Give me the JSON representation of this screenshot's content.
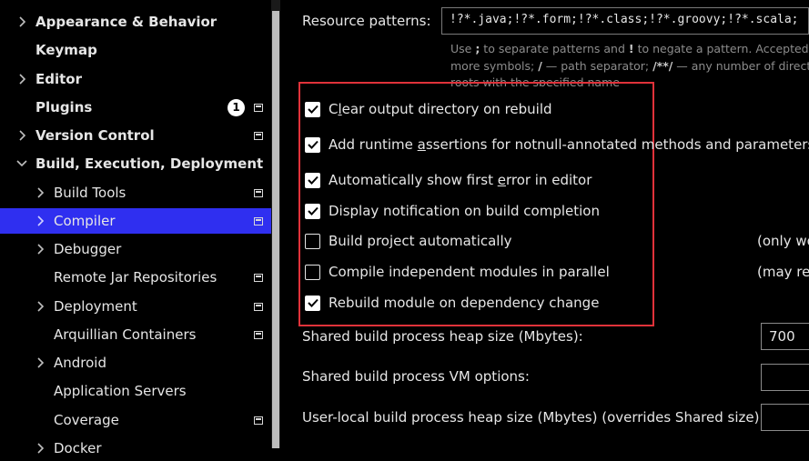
{
  "sidebar": {
    "items": [
      {
        "label": "Appearance & Behavior",
        "bold": true,
        "chevron": "right",
        "project_icon": false
      },
      {
        "label": "Keymap",
        "bold": true,
        "chevron": "none",
        "project_icon": false
      },
      {
        "label": "Editor",
        "bold": true,
        "chevron": "right",
        "project_icon": false
      },
      {
        "label": "Plugins",
        "bold": true,
        "chevron": "none",
        "project_icon": true,
        "badge": "1"
      },
      {
        "label": "Version Control",
        "bold": true,
        "chevron": "right",
        "project_icon": true
      },
      {
        "label": "Build, Execution, Deployment",
        "bold": true,
        "chevron": "down",
        "project_icon": false
      },
      {
        "label": "Build Tools",
        "bold": false,
        "chevron": "right",
        "project_icon": true
      },
      {
        "label": "Compiler",
        "bold": false,
        "chevron": "right",
        "project_icon": true,
        "selected": true
      },
      {
        "label": "Debugger",
        "bold": false,
        "chevron": "right",
        "project_icon": false
      },
      {
        "label": "Remote Jar Repositories",
        "bold": false,
        "chevron": "none",
        "project_icon": true
      },
      {
        "label": "Deployment",
        "bold": false,
        "chevron": "right",
        "project_icon": true
      },
      {
        "label": "Arquillian Containers",
        "bold": false,
        "chevron": "none",
        "project_icon": true
      },
      {
        "label": "Android",
        "bold": false,
        "chevron": "right",
        "project_icon": false
      },
      {
        "label": "Application Servers",
        "bold": false,
        "chevron": "none",
        "project_icon": false
      },
      {
        "label": "Coverage",
        "bold": false,
        "chevron": "none",
        "project_icon": true
      },
      {
        "label": "Docker",
        "bold": false,
        "chevron": "right",
        "project_icon": false
      }
    ]
  },
  "compiler": {
    "resource_patterns_label": "Resource patterns:",
    "resource_patterns_value": "!?*.java;!?*.form;!?*.class;!?*.groovy;!?*.scala;",
    "hint_line1_a": "Use ",
    "hint_line1_sep": ";",
    "hint_line1_b": " to separate patterns and ",
    "hint_line1_neg": "!",
    "hint_line1_c": " to negate a pattern. Accepted w",
    "hint_line2_a": "more symbols; ",
    "hint_line2_slash": "/",
    "hint_line2_b": " — path separator; ",
    "hint_line2_any": "/**/",
    "hint_line2_c": " — any number of directo",
    "hint_line3": "roots with the specified name",
    "options": [
      {
        "pre": "C",
        "mn": "l",
        "post": "ear output directory on rebuild",
        "checked": true
      },
      {
        "pre": "Add runtime ",
        "mn": "a",
        "post": "ssertions for notnull-annotated methods and parameters",
        "checked": true
      },
      {
        "pre": "Automatically show first ",
        "mn": "e",
        "post": "rror in editor",
        "checked": true
      },
      {
        "pre": "Display notification on build completion",
        "mn": "",
        "post": "",
        "checked": true
      },
      {
        "pre": "Build project automatically",
        "mn": "",
        "post": "",
        "checked": false
      },
      {
        "pre": "Compile independent modules in parallel",
        "mn": "",
        "post": "",
        "checked": false
      },
      {
        "pre": "Rebuild module on dependency change",
        "mn": "",
        "post": "",
        "checked": true
      }
    ],
    "note_build_auto": "(only wo",
    "note_parallel": "(may rec",
    "heap_label": "Shared build process heap size (Mbytes):",
    "heap_value": "700",
    "vm_label": "Shared build process VM options:",
    "vm_value": "",
    "user_heap_label": "User-local build process heap size (Mbytes) (overrides Shared size):",
    "user_heap_value": ""
  },
  "colors": {
    "background": "#000000",
    "selection": "#2f2ff0",
    "highlight_border": "#e0323a",
    "text": "#e6e6e6",
    "hint_text": "#8c8c8c"
  }
}
